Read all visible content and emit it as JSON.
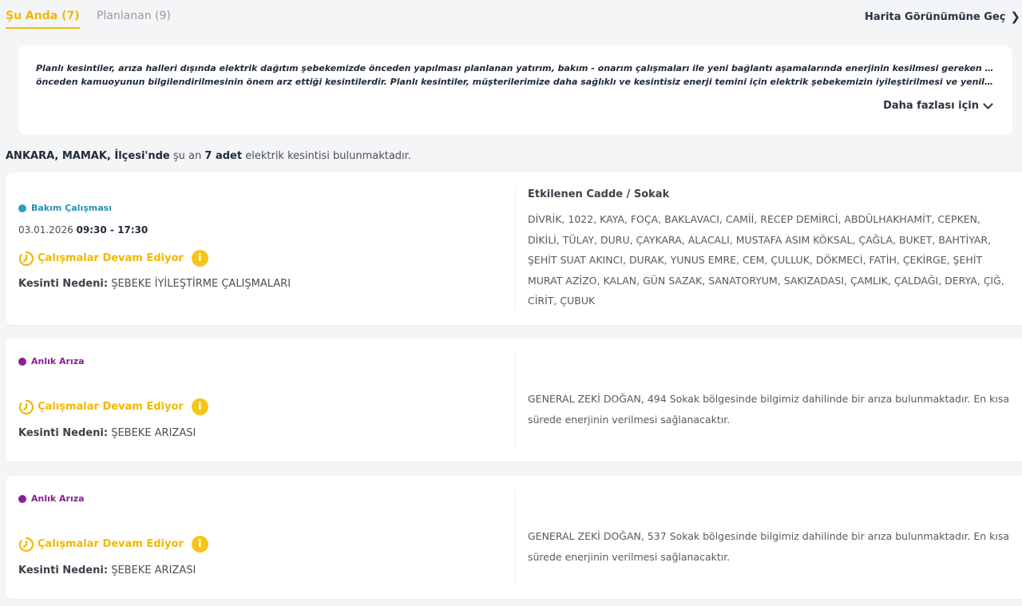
{
  "tabs": {
    "current": "Şu Anda (7)",
    "planned": "Planlanan (9)"
  },
  "map_link": "Harita Görünümüne Geç",
  "info": {
    "line1": "Planlı kesintiler, arıza halleri dışında elektrik dağıtım şebekemizde önceden yapılması planlanan yatırım, bakım - onarım çalışmaları ile yeni bağlantı aşamalarında enerjinin kesilmesi gereken durumlarda",
    "line2": "önceden kamuoyunun bilgilendirilmesinin önem arz ettiği kesintilerdir. Planlı kesintiler, müşterilerimize daha sağlıklı ve kesintisiz enerji temini için elektrik şebekemizin iyileştirilmesi ve yenilenmesi amacıyl...",
    "more": "Daha fazlası için"
  },
  "summary": {
    "location": "ANKARA, MAMAK, İlçesi'nde",
    "mid": "şu an",
    "count": "7 adet",
    "tail": "elektrik kesintisi bulunmaktadır."
  },
  "outages": [
    {
      "type": "Bakım Çalışması",
      "date": "03.01.2026",
      "time": "09:30 - 17:30",
      "status": "Çalışmalar Devam Ediyor",
      "reason_label": "Kesinti Nedeni:",
      "reason": "ŞEBEKE İYİLEŞTİRME ÇALIŞMALARI",
      "affected_title": "Etkilenen Cadde / Sokak",
      "affected": "DİVRİK, 1022, KAYA, FOÇA, BAKLAVACI, CAMİİ, RECEP DEMİRCİ, ABDÜLHAKHAMİT, CEPKEN, DİKİLİ, TÜLAY, DURU, ÇAYKARA, ALACALI, MUSTAFA ASIM KÖKSAL, ÇAĞLA, BUKET, BAHTİYAR, ŞEHİT SUAT AKINCI, DURAK, YUNUS EMRE, CEM, ÇULLUK, DÖKMECİ, FATİH, ÇEKİRGE, ŞEHİT MURAT AZİZO, KALAN, GÜN SAZAK, SANATORYUM, SAKIZADASI, ÇAMLIK, ÇALDAĞI, DERYA, ÇIĞ, CİRİT, ÇUBUK"
    },
    {
      "type": "Anlık Arıza",
      "status": "Çalışmalar Devam Ediyor",
      "reason_label": "Kesinti Nedeni:",
      "reason": "ŞEBEKE ARIZASI",
      "affected": "GENERAL ZEKİ DOĞAN, 494 Sokak bölgesinde bilgimiz dahilinde bir arıza bulunmaktadır. En kısa sürede enerjinin verilmesi sağlanacaktır."
    },
    {
      "type": "Anlık Arıza",
      "status": "Çalışmalar Devam Ediyor",
      "reason_label": "Kesinti Nedeni:",
      "reason": "ŞEBEKE ARIZASI",
      "affected": "GENERAL ZEKİ DOĞAN, 537 Sokak bölgesinde bilgimiz dahilinde bir arıza bulunmaktadır. En kısa sürede enerjinin verilmesi sağlanacaktır."
    }
  ],
  "icons": {
    "status": "progress-clock-icon",
    "info": "info-icon",
    "map_link": "chevron-right-icon",
    "more": "chevron-down-icon"
  },
  "colors": {
    "accent": "#f2b705",
    "maintenance": "#2a9ec7",
    "fault": "#8a1f94",
    "text_dark": "#1f2a38"
  }
}
